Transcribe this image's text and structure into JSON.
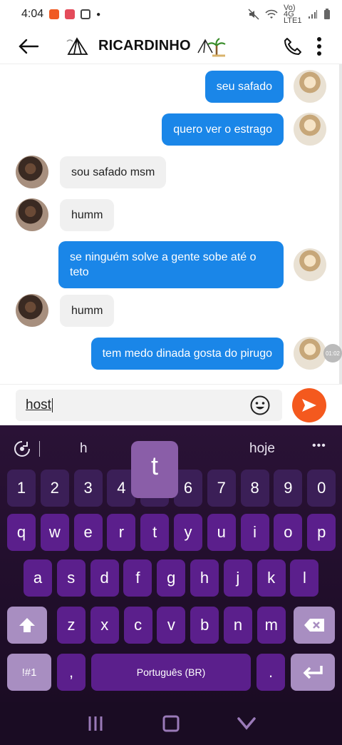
{
  "status_bar": {
    "time": "4:04",
    "network_label": "Vo) 4G LTE1"
  },
  "header": {
    "contact_name": "RICARDINHO",
    "icons": [
      "arrow-left-icon",
      "phone-icon",
      "more-vertical-icon"
    ]
  },
  "messages": [
    {
      "direction": "out",
      "text": "seu safado"
    },
    {
      "direction": "out",
      "text": "quero ver o estrago"
    },
    {
      "direction": "in",
      "text": "sou safado msm"
    },
    {
      "direction": "in",
      "text": "humm"
    },
    {
      "direction": "out",
      "text": "se ninguém solve a gente sobe até o teto"
    },
    {
      "direction": "in",
      "text": "humm"
    },
    {
      "direction": "out",
      "text": "tem medo dinada gosta do pirugo"
    }
  ],
  "timestamp_badge": "01:02",
  "composer": {
    "input_value": "host"
  },
  "keyboard": {
    "suggestions": [
      "h",
      "",
      "hoje"
    ],
    "popup_key": "t",
    "rows": {
      "numbers": [
        "1",
        "2",
        "3",
        "4",
        "5",
        "6",
        "7",
        "8",
        "9",
        "0"
      ],
      "row1": [
        "q",
        "w",
        "e",
        "r",
        "t",
        "y",
        "u",
        "i",
        "o",
        "p"
      ],
      "row2": [
        "a",
        "s",
        "d",
        "f",
        "g",
        "h",
        "j",
        "k",
        "l"
      ],
      "row3": [
        "z",
        "x",
        "c",
        "v",
        "b",
        "n",
        "m"
      ]
    },
    "symbols_label": "!#1",
    "comma_label": ",",
    "space_label": "Português (BR)",
    "period_label": "."
  },
  "colors": {
    "outgoing_bubble": "#1a86e8",
    "incoming_bubble": "#f0f0f0",
    "send_button": "#f4591e",
    "keyboard_key": "#5b1f8c"
  }
}
